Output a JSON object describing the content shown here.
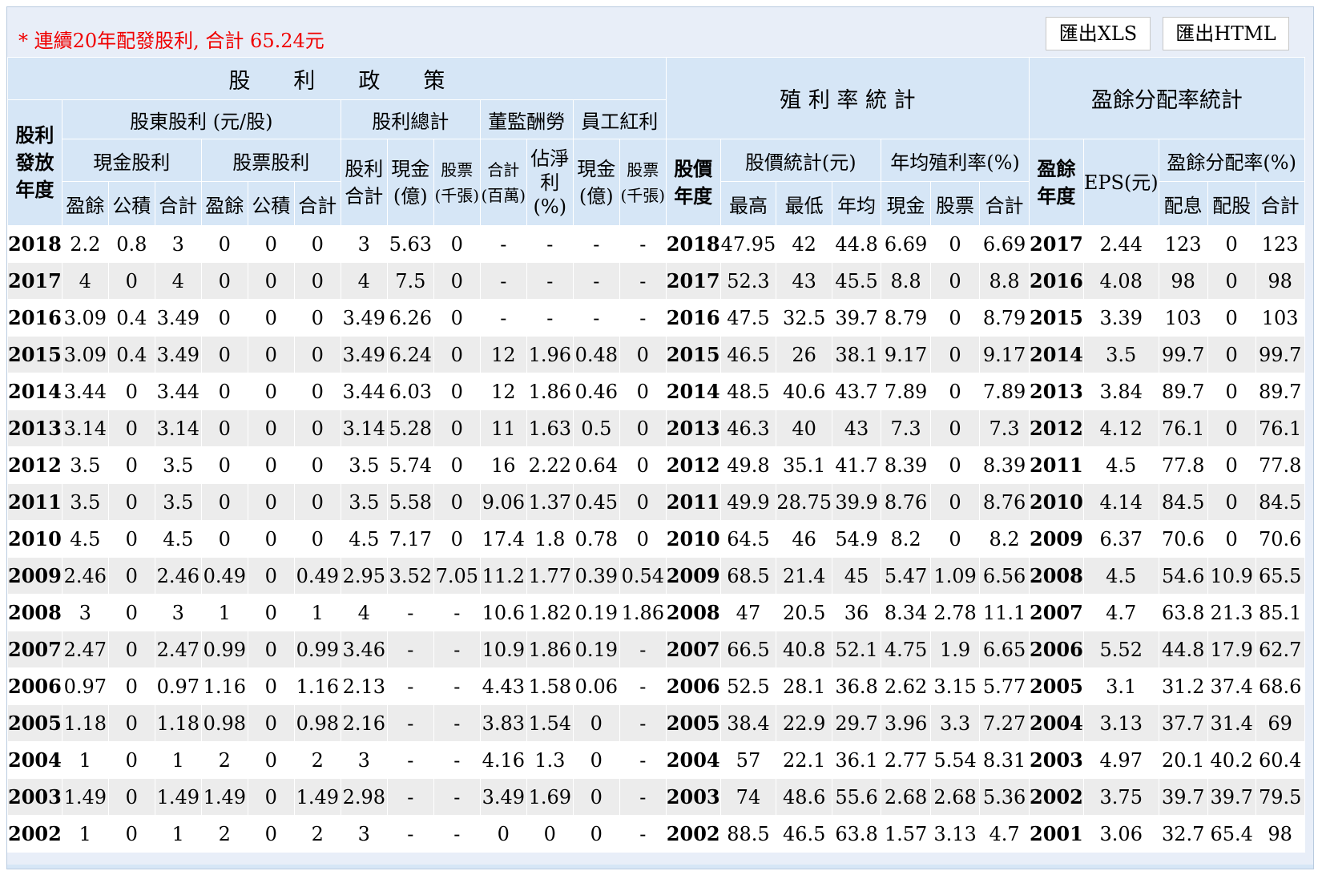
{
  "note": "* 連續20年配發股利, 合計 65.24元",
  "buttons": {
    "xls": "匯出XLS",
    "html": "匯出HTML"
  },
  "headers": {
    "policy": "股　　利　　政　　策",
    "yield_stats": "殖 利 率 統 計",
    "payout_stats": "盈餘分配率統計",
    "year_col": "股利發放年度",
    "shareholder_div": "股東股利 (元/股)",
    "div_total": "股利總計",
    "director_pay": "董監酬勞",
    "employee_bonus": "員工紅利",
    "cash_div": "現金股利",
    "stock_div": "股票股利",
    "div_sum": "股利合計",
    "cash_100m": "現金(億)",
    "stock_kshares": "股票(千張)",
    "sum_1m": "合計(百萬)",
    "est_net": "佔淨利(%)",
    "emp_cash": "現金(億)",
    "emp_stock": "股票(千張)",
    "price_year": "股價年度",
    "price_stats": "股價統計(元)",
    "avg_yield": "年均殖利率(%)",
    "earn_year": "盈餘年度",
    "eps": "EPS(元)",
    "payout_rate": "盈餘分配率(%)",
    "earnings": "盈餘",
    "reserve": "公積",
    "total": "合計",
    "high": "最高",
    "low": "最低",
    "avg": "年均",
    "cash": "現金",
    "stock": "股票",
    "pay_cash": "配息",
    "pay_stock": "配股"
  },
  "rows": [
    [
      "2018",
      "2.2",
      "0.8",
      "3",
      "0",
      "0",
      "0",
      "3",
      "5.63",
      "0",
      "-",
      "-",
      "-",
      "-",
      "2018",
      "47.95",
      "42",
      "44.8",
      "6.69",
      "0",
      "6.69",
      "2017",
      "2.44",
      "123",
      "0",
      "123"
    ],
    [
      "2017",
      "4",
      "0",
      "4",
      "0",
      "0",
      "0",
      "4",
      "7.5",
      "0",
      "-",
      "-",
      "-",
      "-",
      "2017",
      "52.3",
      "43",
      "45.5",
      "8.8",
      "0",
      "8.8",
      "2016",
      "4.08",
      "98",
      "0",
      "98"
    ],
    [
      "2016",
      "3.09",
      "0.4",
      "3.49",
      "0",
      "0",
      "0",
      "3.49",
      "6.26",
      "0",
      "-",
      "-",
      "-",
      "-",
      "2016",
      "47.5",
      "32.5",
      "39.7",
      "8.79",
      "0",
      "8.79",
      "2015",
      "3.39",
      "103",
      "0",
      "103"
    ],
    [
      "2015",
      "3.09",
      "0.4",
      "3.49",
      "0",
      "0",
      "0",
      "3.49",
      "6.24",
      "0",
      "12",
      "1.96",
      "0.48",
      "0",
      "2015",
      "46.5",
      "26",
      "38.1",
      "9.17",
      "0",
      "9.17",
      "2014",
      "3.5",
      "99.7",
      "0",
      "99.7"
    ],
    [
      "2014",
      "3.44",
      "0",
      "3.44",
      "0",
      "0",
      "0",
      "3.44",
      "6.03",
      "0",
      "12",
      "1.86",
      "0.46",
      "0",
      "2014",
      "48.5",
      "40.6",
      "43.7",
      "7.89",
      "0",
      "7.89",
      "2013",
      "3.84",
      "89.7",
      "0",
      "89.7"
    ],
    [
      "2013",
      "3.14",
      "0",
      "3.14",
      "0",
      "0",
      "0",
      "3.14",
      "5.28",
      "0",
      "11",
      "1.63",
      "0.5",
      "0",
      "2013",
      "46.3",
      "40",
      "43",
      "7.3",
      "0",
      "7.3",
      "2012",
      "4.12",
      "76.1",
      "0",
      "76.1"
    ],
    [
      "2012",
      "3.5",
      "0",
      "3.5",
      "0",
      "0",
      "0",
      "3.5",
      "5.74",
      "0",
      "16",
      "2.22",
      "0.64",
      "0",
      "2012",
      "49.8",
      "35.1",
      "41.7",
      "8.39",
      "0",
      "8.39",
      "2011",
      "4.5",
      "77.8",
      "0",
      "77.8"
    ],
    [
      "2011",
      "3.5",
      "0",
      "3.5",
      "0",
      "0",
      "0",
      "3.5",
      "5.58",
      "0",
      "9.06",
      "1.37",
      "0.45",
      "0",
      "2011",
      "49.9",
      "28.75",
      "39.9",
      "8.76",
      "0",
      "8.76",
      "2010",
      "4.14",
      "84.5",
      "0",
      "84.5"
    ],
    [
      "2010",
      "4.5",
      "0",
      "4.5",
      "0",
      "0",
      "0",
      "4.5",
      "7.17",
      "0",
      "17.4",
      "1.8",
      "0.78",
      "0",
      "2010",
      "64.5",
      "46",
      "54.9",
      "8.2",
      "0",
      "8.2",
      "2009",
      "6.37",
      "70.6",
      "0",
      "70.6"
    ],
    [
      "2009",
      "2.46",
      "0",
      "2.46",
      "0.49",
      "0",
      "0.49",
      "2.95",
      "3.52",
      "7.05",
      "11.2",
      "1.77",
      "0.39",
      "0.54",
      "2009",
      "68.5",
      "21.4",
      "45",
      "5.47",
      "1.09",
      "6.56",
      "2008",
      "4.5",
      "54.6",
      "10.9",
      "65.5"
    ],
    [
      "2008",
      "3",
      "0",
      "3",
      "1",
      "0",
      "1",
      "4",
      "-",
      "-",
      "10.6",
      "1.82",
      "0.19",
      "1.86",
      "2008",
      "47",
      "20.5",
      "36",
      "8.34",
      "2.78",
      "11.1",
      "2007",
      "4.7",
      "63.8",
      "21.3",
      "85.1"
    ],
    [
      "2007",
      "2.47",
      "0",
      "2.47",
      "0.99",
      "0",
      "0.99",
      "3.46",
      "-",
      "-",
      "10.9",
      "1.86",
      "0.19",
      "-",
      "2007",
      "66.5",
      "40.8",
      "52.1",
      "4.75",
      "1.9",
      "6.65",
      "2006",
      "5.52",
      "44.8",
      "17.9",
      "62.7"
    ],
    [
      "2006",
      "0.97",
      "0",
      "0.97",
      "1.16",
      "0",
      "1.16",
      "2.13",
      "-",
      "-",
      "4.43",
      "1.58",
      "0.06",
      "-",
      "2006",
      "52.5",
      "28.1",
      "36.8",
      "2.62",
      "3.15",
      "5.77",
      "2005",
      "3.1",
      "31.2",
      "37.4",
      "68.6"
    ],
    [
      "2005",
      "1.18",
      "0",
      "1.18",
      "0.98",
      "0",
      "0.98",
      "2.16",
      "-",
      "-",
      "3.83",
      "1.54",
      "0",
      "-",
      "2005",
      "38.4",
      "22.9",
      "29.7",
      "3.96",
      "3.3",
      "7.27",
      "2004",
      "3.13",
      "37.7",
      "31.4",
      "69"
    ],
    [
      "2004",
      "1",
      "0",
      "1",
      "2",
      "0",
      "2",
      "3",
      "-",
      "-",
      "4.16",
      "1.3",
      "0",
      "-",
      "2004",
      "57",
      "22.1",
      "36.1",
      "2.77",
      "5.54",
      "8.31",
      "2003",
      "4.97",
      "20.1",
      "40.2",
      "60.4"
    ],
    [
      "2003",
      "1.49",
      "0",
      "1.49",
      "1.49",
      "0",
      "1.49",
      "2.98",
      "-",
      "-",
      "3.49",
      "1.69",
      "0",
      "-",
      "2003",
      "74",
      "48.6",
      "55.6",
      "2.68",
      "2.68",
      "5.36",
      "2002",
      "3.75",
      "39.7",
      "39.7",
      "79.5"
    ],
    [
      "2002",
      "1",
      "0",
      "1",
      "2",
      "0",
      "2",
      "3",
      "-",
      "-",
      "0",
      "0",
      "0",
      "-",
      "2002",
      "88.5",
      "46.5",
      "63.8",
      "1.57",
      "3.13",
      "4.7",
      "2001",
      "3.06",
      "32.7",
      "65.4",
      "98"
    ]
  ]
}
